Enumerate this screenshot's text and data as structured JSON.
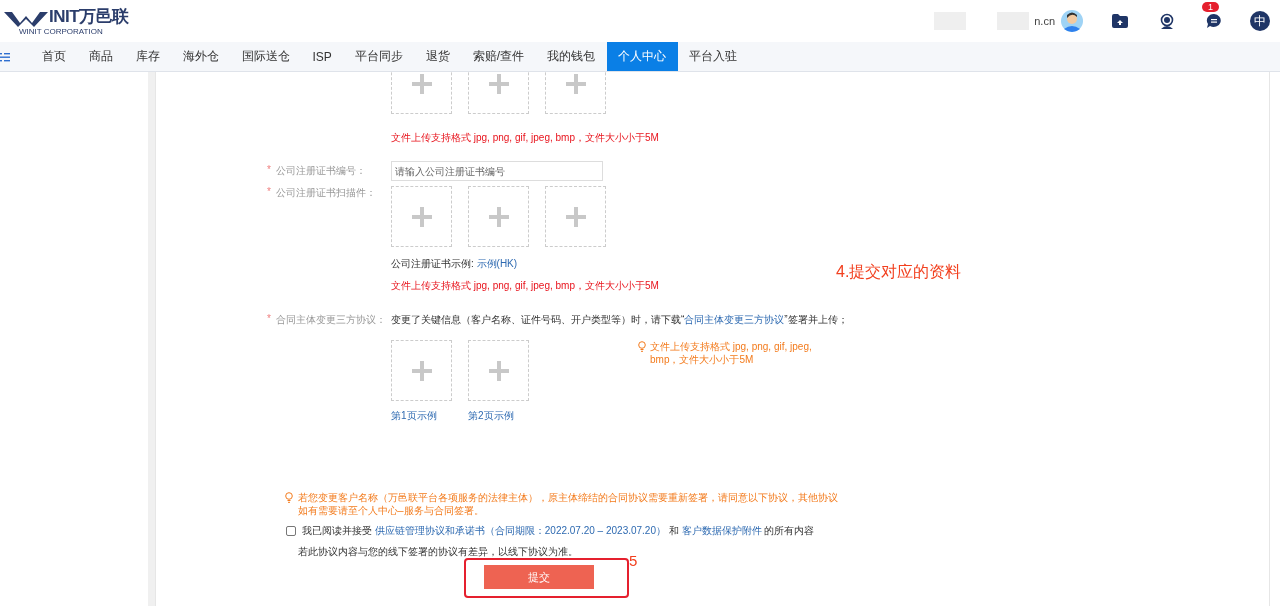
{
  "header": {
    "logo": {
      "wordmark": "INIT万邑联",
      "subtitle": "WINIT CORPORATION"
    },
    "user": {
      "account": "n.cn"
    },
    "notifications": {
      "badge": "1"
    },
    "language": "中"
  },
  "nav": [
    {
      "label": "首页",
      "selected": false
    },
    {
      "label": "商品",
      "selected": false
    },
    {
      "label": "库存",
      "selected": false
    },
    {
      "label": "海外仓",
      "selected": false
    },
    {
      "label": "国际送仓",
      "selected": false
    },
    {
      "label": "ISP",
      "selected": false
    },
    {
      "label": "平台同步",
      "selected": false
    },
    {
      "label": "退货",
      "selected": false
    },
    {
      "label": "索赔/查件",
      "selected": false
    },
    {
      "label": "我的钱包",
      "selected": false
    },
    {
      "label": "个人中心",
      "selected": true
    },
    {
      "label": "平台入驻",
      "selected": false
    }
  ],
  "form": [
    {
      "kind": "upload",
      "slots": [
        {
          "filled": false
        },
        {
          "filled": false
        },
        {
          "filled": false
        }
      ],
      "hint": "文件上传支持格式 jpg, png, gif, jpeg, bmp，文件大小小于5M"
    },
    {
      "kind": "text",
      "required_mark": "*",
      "label": "公司注册证书编号：",
      "placeholder": "请输入公司注册证书编号"
    },
    {
      "kind": "upload",
      "required_mark": "*",
      "label": "公司注册证书扫描件：",
      "slots": [
        {
          "filled": false
        },
        {
          "filled": false
        },
        {
          "filled": false
        }
      ],
      "example": {
        "text": "公司注册证书示例: ",
        "link": "示例(HK)"
      },
      "hint": "文件上传支持格式 jpg, png, gif, jpeg, bmp，文件大小小于5M"
    },
    {
      "kind": "contract",
      "required_mark": "*",
      "label": "合同主体变更三方协议：",
      "note": {
        "before": "变更了关键信息（客户名称、证件号码、开户类型等）时，请下载“",
        "link": "合同主体变更三方协议",
        "after": "”签署并上传；"
      },
      "slots": [
        {
          "filled": false,
          "caption": "第1页示例"
        },
        {
          "filled": false,
          "caption": "第2页示例"
        }
      ],
      "tip": "文件上传支持格式 jpg, png, gif, jpeg, bmp，文件大小小于5M"
    }
  ],
  "notice": "若您变更客户名称（万邑联平台各项服务的法律主体），原主体缔结的合同协议需要重新签署，请同意以下协议，其他协议如有需要请至个人中心–服务与合同签署。",
  "agreement": {
    "checked": false,
    "parts": [
      {
        "text": "我已阅读并接受 ",
        "link": false
      },
      {
        "text": "供应链管理协议和承诺书（合同期限：2022.07.20 – 2023.07.20）",
        "link": true
      },
      {
        "text": " 和 ",
        "link": false
      },
      {
        "text": "客户数据保护附件",
        "link": true
      },
      {
        "text": " 的所有内容",
        "link": false
      }
    ]
  },
  "disclaimer": "若此协议内容与您的线下签署的协议有差异，以线下协议为准。",
  "submit": "提交",
  "annotations": [
    {
      "kind": "label",
      "text": "4.提交对应的资料"
    },
    {
      "kind": "frame",
      "text": "5"
    }
  ]
}
